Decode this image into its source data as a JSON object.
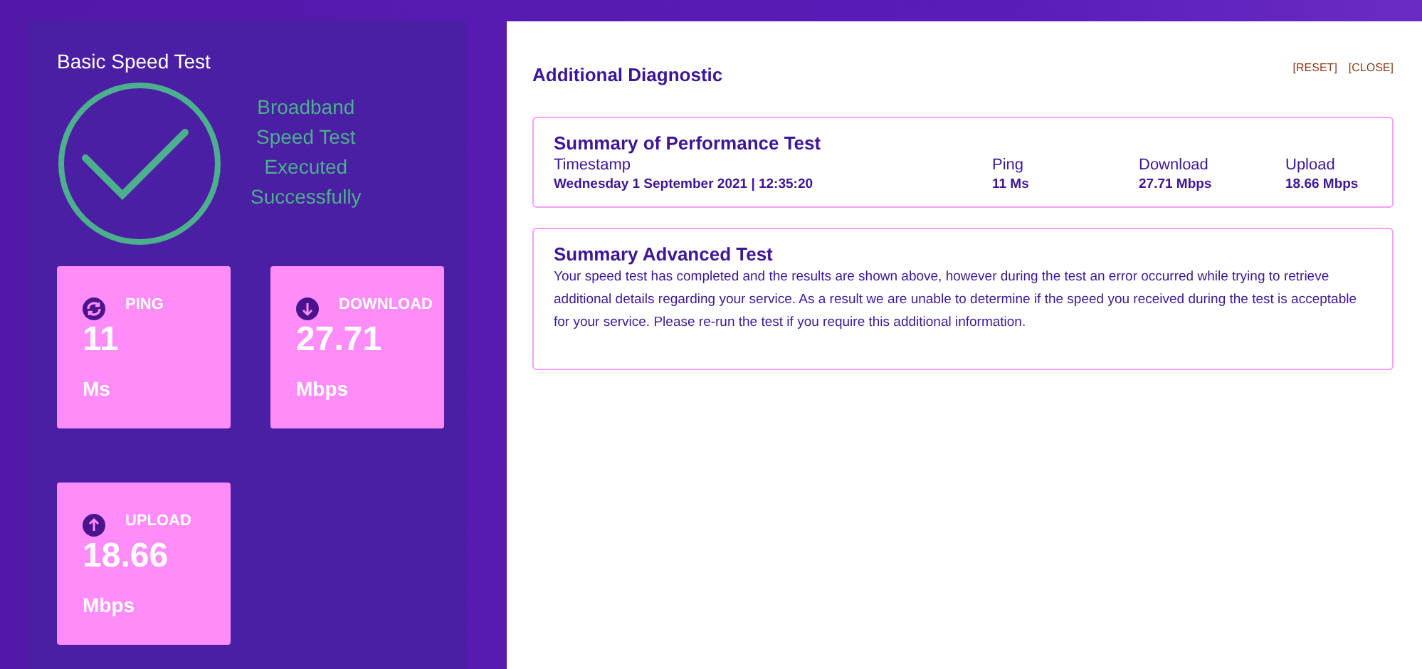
{
  "basic_test": {
    "title": "Basic Speed Test",
    "status_lines": [
      "Broadband",
      "Speed Test",
      "Executed",
      "Successfully"
    ],
    "tiles": [
      {
        "kind": "ping",
        "label": "PING",
        "value": "11",
        "unit": "Ms"
      },
      {
        "kind": "download",
        "label": "DOWNLOAD",
        "value": "27.71",
        "unit": "Mbps"
      },
      {
        "kind": "upload",
        "label": "UPLOAD",
        "value": "18.66",
        "unit": "Mbps"
      }
    ]
  },
  "diagnostic": {
    "title": "Additional Diagnostic",
    "links": [
      "[RESET]",
      "[CLOSE]"
    ],
    "performance": {
      "title": "Summary of Performance Test",
      "columns": [
        {
          "label": "Timestamp",
          "value": "Wednesday 1 September 2021 | 12:35:20"
        },
        {
          "label": "Ping",
          "value": "11 Ms"
        },
        {
          "label": "Download",
          "value": "27.71 Mbps"
        },
        {
          "label": "Upload",
          "value": "18.66 Mbps"
        }
      ]
    },
    "advanced": {
      "title": "Summary Advanced Test",
      "text": "Your speed test has completed and the results are shown above, however during the test an error occurred while trying to retrieve additional details regarding your service. As a result we are unable to determine if the speed you received during the test is acceptable for your service. Please re-run the test if you require this additional information."
    }
  }
}
